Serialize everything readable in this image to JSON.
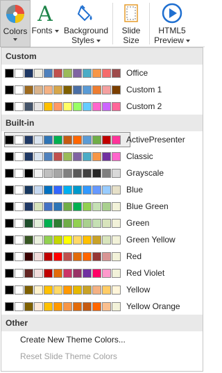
{
  "ribbon": {
    "colors": {
      "line1": "Colors"
    },
    "fonts": {
      "line1": "Fonts"
    },
    "background": {
      "line1": "Background",
      "line2": "Styles"
    },
    "slide_size": {
      "line1": "Slide",
      "line2": "Size"
    },
    "html5": {
      "line1": "HTML5",
      "line2": "Preview"
    }
  },
  "sections": {
    "custom": "Custom",
    "builtin": "Built-in",
    "other": "Other"
  },
  "themes": [
    {
      "name": "Office",
      "section": "custom",
      "colors": [
        "#000000",
        "#ffffff",
        "#1f3864",
        "#eeece1",
        "#4f81bd",
        "#c0504d",
        "#9bbb59",
        "#8064a2",
        "#4bacc6",
        "#f79646",
        "#f56b6b",
        "#9e4a4a"
      ]
    },
    {
      "name": "Custom 1",
      "section": "custom",
      "colors": [
        "#000000",
        "#ffffff",
        "#9e6a1e",
        "#d9b38c",
        "#f4b183",
        "#d6a64a",
        "#7f6000",
        "#4a6fa5",
        "#5a9bd5",
        "#ed7d31",
        "#f4a0a0",
        "#7b3f00"
      ]
    },
    {
      "name": "Custom 2",
      "section": "custom",
      "colors": [
        "#000000",
        "#ffffff",
        "#44546a",
        "#e7e6e6",
        "#ffc000",
        "#ff9966",
        "#ffff66",
        "#99ff66",
        "#66ccff",
        "#ff66cc",
        "#cc66ff",
        "#ff6699"
      ]
    },
    {
      "name": "ActivePresenter",
      "section": "builtin",
      "selected": true,
      "colors": [
        "#000000",
        "#ffffff",
        "#1f3864",
        "#dbe5f1",
        "#2e74b5",
        "#00b050",
        "#c55a11",
        "#ff6600",
        "#5b9bd5",
        "#70ad47",
        "#c00000",
        "#ff3399"
      ]
    },
    {
      "name": "Classic",
      "section": "builtin",
      "colors": [
        "#000000",
        "#ffffff",
        "#1f3864",
        "#dbe5f1",
        "#4f81bd",
        "#c0504d",
        "#9bbb59",
        "#8064a2",
        "#4bacc6",
        "#f79646",
        "#7030a0",
        "#ff66cc"
      ]
    },
    {
      "name": "Grayscale",
      "section": "builtin",
      "colors": [
        "#000000",
        "#ffffff",
        "#000000",
        "#f2f2f2",
        "#bfbfbf",
        "#a6a6a6",
        "#808080",
        "#595959",
        "#404040",
        "#262626",
        "#7f7f7f",
        "#d9d9d9"
      ]
    },
    {
      "name": "Blue",
      "section": "builtin",
      "colors": [
        "#000000",
        "#ffffff",
        "#17375e",
        "#c6d9f1",
        "#0070c0",
        "#3366ff",
        "#00b0f0",
        "#0099cc",
        "#3399ff",
        "#6699ff",
        "#99ccff",
        "#e6e0c8"
      ]
    },
    {
      "name": "Blue Green",
      "section": "builtin",
      "colors": [
        "#000000",
        "#ffffff",
        "#1f3864",
        "#d8e4bc",
        "#4472c4",
        "#2e75b6",
        "#70ad47",
        "#00b050",
        "#92d050",
        "#c5e0b4",
        "#a9d08e",
        "#f2f2d9"
      ]
    },
    {
      "name": "Green",
      "section": "builtin",
      "colors": [
        "#000000",
        "#ffffff",
        "#1e4d2b",
        "#e2efda",
        "#00b050",
        "#2e7d32",
        "#70ad47",
        "#92d050",
        "#a9d08e",
        "#c5e0b4",
        "#d8e4bc",
        "#f2f2d9"
      ]
    },
    {
      "name": "Green Yellow",
      "section": "builtin",
      "colors": [
        "#000000",
        "#ffffff",
        "#375623",
        "#ebf1de",
        "#92d050",
        "#c4d600",
        "#ffff00",
        "#ffd966",
        "#ffc000",
        "#c9a227",
        "#d8e4bc",
        "#f2f2d9"
      ]
    },
    {
      "name": "Red",
      "section": "builtin",
      "colors": [
        "#000000",
        "#ffffff",
        "#3a0000",
        "#f2dcdb",
        "#c00000",
        "#ff0000",
        "#c0504d",
        "#e26b0a",
        "#ff6600",
        "#963634",
        "#d99594",
        "#f2f2d9"
      ]
    },
    {
      "name": "Red Violet",
      "section": "builtin",
      "colors": [
        "#000000",
        "#ffffff",
        "#632523",
        "#f2dcdb",
        "#c00000",
        "#e26b0a",
        "#cc3366",
        "#993366",
        "#7030a0",
        "#ff0066",
        "#ff99cc",
        "#f2f2d9"
      ]
    },
    {
      "name": "Yellow",
      "section": "builtin",
      "colors": [
        "#000000",
        "#ffffff",
        "#7f6000",
        "#fff2cc",
        "#ffc000",
        "#ffd966",
        "#ff9900",
        "#e6b800",
        "#c9a227",
        "#f4b183",
        "#ffcc66",
        "#fff5d9"
      ]
    },
    {
      "name": "Yellow Orange",
      "section": "builtin",
      "colors": [
        "#000000",
        "#ffffff",
        "#7f6000",
        "#fde9d9",
        "#ffc000",
        "#ff9900",
        "#f79646",
        "#e26b0a",
        "#c55a11",
        "#ff6600",
        "#fabf8f",
        "#f2f2d9"
      ]
    }
  ],
  "other_items": {
    "create_new": "Create New Theme Colors...",
    "reset": "Reset Slide Theme Colors"
  },
  "icon_colors": {
    "palette_red": "#e84c3d",
    "palette_yellow": "#f1c40f",
    "palette_blue": "#3498db",
    "palette_gray": "#7f8c8d",
    "fonts_green": "#1e8449",
    "html5_blue": "#1f6fd0"
  }
}
